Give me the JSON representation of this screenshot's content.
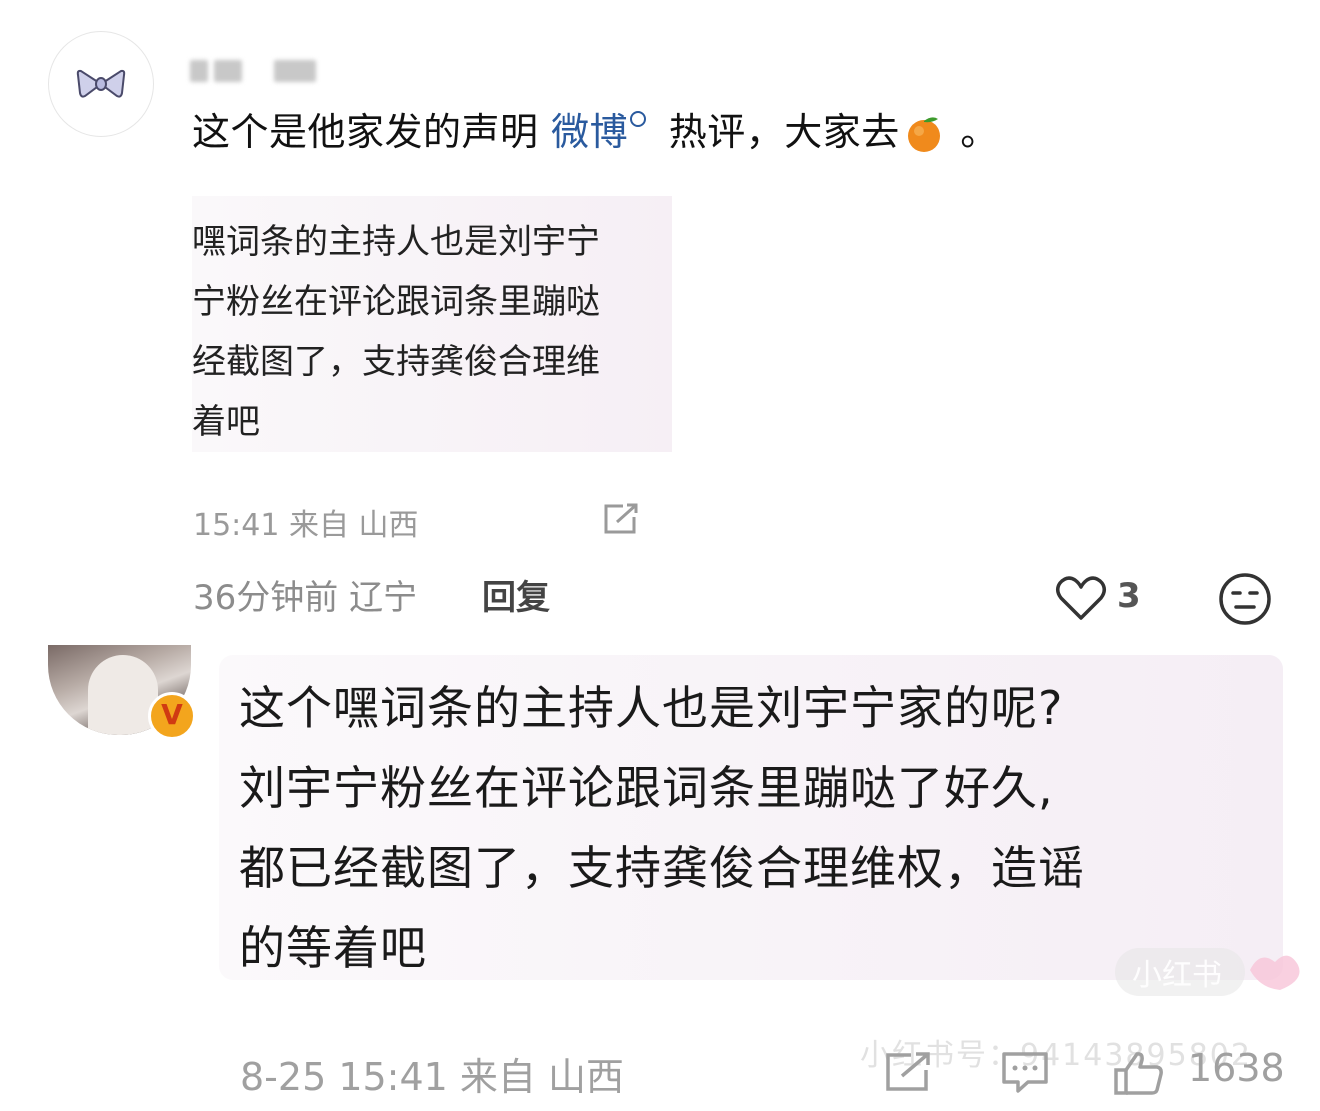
{
  "comment1": {
    "text_before_link": "这个是他家发的声明 ",
    "link_text": "微博",
    "text_after_link": " 热评，大家去",
    "text_end": " 。",
    "quote_text": "嘿词条的主持人也是刘宇宁\n宁粉丝在评论跟词条里蹦哒\n经截图了，支持龚俊合理维\n着吧",
    "meta": "15:41 来自 山西",
    "time_location": "36分钟前 辽宁",
    "reply_label": "回复",
    "like_count": "3"
  },
  "comment2": {
    "badge": "V",
    "lines": [
      "这个嘿词条的主持人也是刘宇宁家的呢?",
      "刘宇宁粉丝在评论跟词条里蹦哒了好久,",
      "都已经截图了，支持龚俊合理维权，造谣",
      "的等着吧"
    ],
    "meta": "8-25 15:41 来自 山西",
    "like_count": "1638"
  },
  "watermark": {
    "logo_text": "小红书",
    "id_text": "小红书号：941438958​02"
  },
  "colors": {
    "link": "#2a5a9e",
    "badge_bg": "#f3a51d",
    "meta_text": "#9a9a9a"
  },
  "icons": [
    "bow-icon",
    "orange-emoji-icon",
    "share-icon",
    "heart-icon",
    "neutral-face-icon",
    "verified-badge-icon",
    "comment-icon",
    "thumb-up-icon"
  ]
}
